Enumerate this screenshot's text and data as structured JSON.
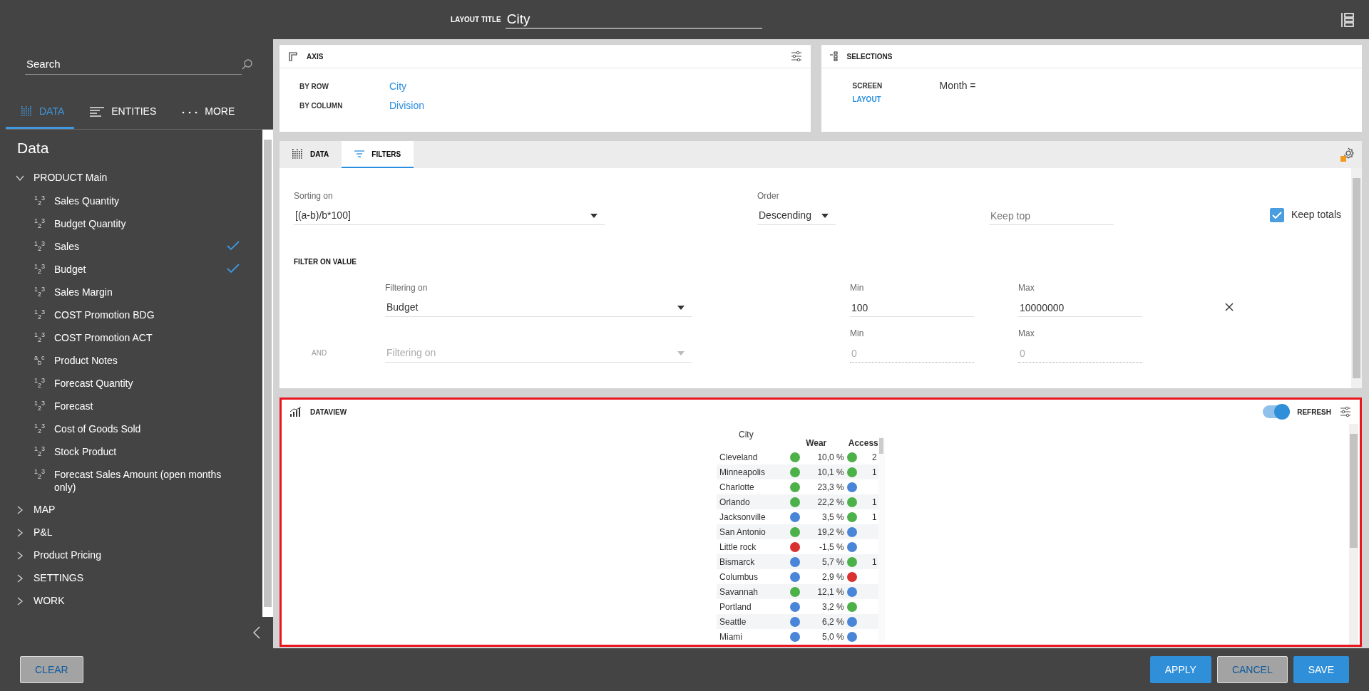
{
  "header": {
    "title_label": "LAYOUT TITLE",
    "title_value": "City"
  },
  "sidebar": {
    "search": {
      "placeholder": "Search"
    },
    "tabs": [
      {
        "label": "DATA",
        "selected": true,
        "kind": "data"
      },
      {
        "label": "ENTITIES",
        "selected": false,
        "kind": "entities"
      },
      {
        "label": "MORE",
        "selected": false,
        "kind": "more"
      }
    ],
    "heading": "Data",
    "tree": [
      {
        "label": "PRODUCT Main",
        "expanded": true,
        "children": [
          {
            "glyph": "$^{1}$$_{2}$$^{3}$",
            "label": "Sales Quantity",
            "checked": false
          },
          {
            "glyph": "$^{1}$$_{2}$$^{3}$",
            "label": "Budget Quantity",
            "checked": false
          },
          {
            "glyph": "$^{1}$$_{2}$$^{3}$",
            "label": "Sales",
            "checked": true
          },
          {
            "glyph": "$^{1}$$_{2}$$^{3}$",
            "label": "Budget",
            "checked": true
          },
          {
            "glyph": "$^{1}$$_{2}$$^{3}$",
            "label": "Sales Margin",
            "checked": false
          },
          {
            "glyph": "$^{1}$$_{2}$$^{3}$",
            "label": "COST Promotion BDG",
            "checked": false
          },
          {
            "glyph": "$^{1}$$_{2}$$^{3}$",
            "label": "COST Promotion ACT",
            "checked": false
          },
          {
            "glyph": "$^{a}$$_{b}$$^{c}$",
            "label": "Product Notes",
            "checked": false
          },
          {
            "glyph": "$^{1}$$_{2}$$^{3}$",
            "label": "Forecast Quantity",
            "checked": false
          },
          {
            "glyph": "$^{1}$$_{2}$$^{3}$",
            "label": "Forecast",
            "checked": false
          },
          {
            "glyph": "$^{1}$$_{2}$$^{3}$",
            "label": "Cost of Goods Sold",
            "checked": false
          },
          {
            "glyph": "$^{1}$$_{2}$$^{3}$",
            "label": "Stock Product",
            "checked": false
          },
          {
            "glyph": "$^{1}$$_{2}$$^{3}$",
            "label": "Forecast Sales Amount (open months only)",
            "checked": false
          }
        ]
      },
      {
        "label": "MAP",
        "expanded": false
      },
      {
        "label": "P&L",
        "expanded": false
      },
      {
        "label": "Product Pricing",
        "expanded": false
      },
      {
        "label": "SETTINGS",
        "expanded": false
      },
      {
        "label": "WORK",
        "expanded": false
      }
    ]
  },
  "axis": {
    "title": "AXIS",
    "rows": [
      {
        "label": "BY ROW",
        "value": "City"
      },
      {
        "label": "BY COLUMN",
        "value": "Division"
      }
    ]
  },
  "selections": {
    "title": "SELECTIONS",
    "rows": [
      {
        "label": "SCREEN",
        "value": "Month =",
        "kind": "plain"
      },
      {
        "label": "LAYOUT",
        "kind": "link"
      }
    ]
  },
  "filters": {
    "tabs": [
      {
        "label": "DATA",
        "selected": false,
        "kind": "data"
      },
      {
        "label": "FILTERS",
        "selected": true,
        "kind": "filters"
      }
    ],
    "sorting": {
      "label": "Sorting on",
      "value": "[(a-b)/b*100]"
    },
    "order": {
      "label": "Order",
      "value": "Descending"
    },
    "keep_top": {
      "placeholder": "Keep top"
    },
    "keep_totals": {
      "label": "Keep totals",
      "checked": true
    },
    "section_title": "FILTER ON VALUE",
    "rows": [
      {
        "filter_label": "Filtering on",
        "value": "Budget",
        "min_label": "Min",
        "min": "100",
        "max_label": "Max",
        "max": "10000000",
        "disabled": false,
        "removable": true
      },
      {
        "prefix": "AND",
        "placeholder": "Filtering on",
        "min_label": "Min",
        "min": "0",
        "max_label": "Max",
        "max": "0",
        "disabled": true,
        "removable": false
      }
    ]
  },
  "dataview": {
    "title": "DATAVIEW",
    "refresh": {
      "label": "REFRESH",
      "on": true
    },
    "table": {
      "columns": [
        "City",
        "Wear",
        "Access"
      ],
      "rows": [
        {
          "city": "Cleveland",
          "wear": {
            "value": "10,0 %",
            "color": "#4db14a"
          },
          "access": {
            "color": "#4db14a",
            "value": "2"
          }
        },
        {
          "city": "Minneapolis",
          "wear": {
            "value": "10,1 %",
            "color": "#4db14a"
          },
          "access": {
            "color": "#4db14a",
            "value": "1"
          }
        },
        {
          "city": "Charlotte",
          "wear": {
            "value": "23,3 %",
            "color": "#4db14a"
          },
          "access": {
            "color": "#4a86d8"
          }
        },
        {
          "city": "Orlando",
          "wear": {
            "value": "22,2 %",
            "color": "#4db14a"
          },
          "access": {
            "color": "#4db14a",
            "value": "1"
          }
        },
        {
          "city": "Jacksonville",
          "wear": {
            "value": "3,5 %",
            "color": "#4a86d8"
          },
          "access": {
            "color": "#4db14a",
            "value": "1"
          }
        },
        {
          "city": "San Antonio",
          "wear": {
            "value": "19,2 %",
            "color": "#4db14a"
          },
          "access": {
            "color": "#4a86d8"
          }
        },
        {
          "city": "Little rock",
          "wear": {
            "value": "-1,5 %",
            "color": "#d9312f"
          },
          "access": {
            "color": "#4a86d8"
          }
        },
        {
          "city": "Bismarck",
          "wear": {
            "value": "5,7 %",
            "color": "#4a86d8"
          },
          "access": {
            "color": "#4db14a",
            "value": "1"
          }
        },
        {
          "city": "Columbus",
          "wear": {
            "value": "2,9 %",
            "color": "#4a86d8"
          },
          "access": {
            "color": "#d9312f"
          }
        },
        {
          "city": "Savannah",
          "wear": {
            "value": "12,1 %",
            "color": "#4db14a"
          },
          "access": {
            "color": "#4a86d8"
          }
        },
        {
          "city": "Portland",
          "wear": {
            "value": "3,2 %",
            "color": "#4a86d8"
          },
          "access": {
            "color": "#4db14a"
          }
        },
        {
          "city": "Seattle",
          "wear": {
            "value": "6,2 %",
            "color": "#4a86d8"
          },
          "access": {
            "color": "#4a86d8"
          }
        },
        {
          "city": "Miami",
          "wear": {
            "value": "5,0 %",
            "color": "#4a86d8"
          },
          "access": {
            "color": "#4a86d8"
          }
        }
      ]
    }
  },
  "footer": {
    "buttons": [
      {
        "label": "CLEAR",
        "disabled": true
      },
      {
        "label": "APPLY",
        "disabled": false
      },
      {
        "label": "CANCEL",
        "disabled": true
      },
      {
        "label": "SAVE",
        "disabled": false
      }
    ]
  }
}
